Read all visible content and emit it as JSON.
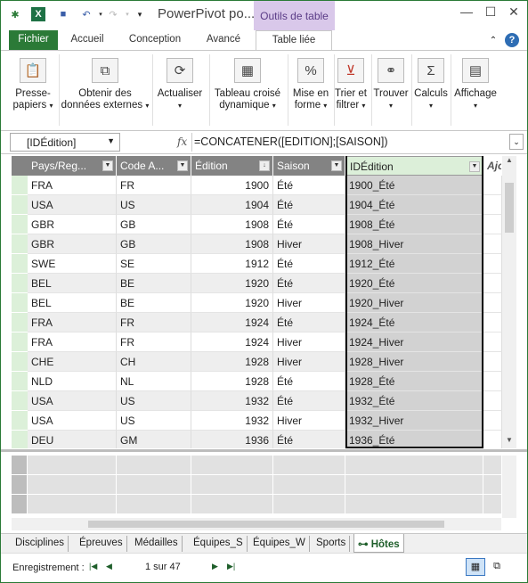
{
  "title_bar": {
    "app_title": "PowerPivot po...",
    "contextual_tab": "Outils de table",
    "minimize": "—",
    "maximize": "☐",
    "close": "✕"
  },
  "ribbon_tabs": [
    "Fichier",
    "Accueil",
    "Conception",
    "Avancé",
    "Table liée"
  ],
  "ribbon_groups": [
    {
      "line1": "Presse-",
      "line2": "papiers",
      "icon": "clipboard-icon"
    },
    {
      "line1": "Obtenir des",
      "line2": "données externes",
      "icon": "external-data-icon"
    },
    {
      "line1": "Actualiser",
      "line2": "",
      "icon": "refresh-icon"
    },
    {
      "line1": "Tableau croisé",
      "line2": "dynamique",
      "icon": "pivot-table-icon"
    },
    {
      "line1": "Mise en",
      "line2": "forme",
      "icon": "percent-format-icon"
    },
    {
      "line1": "Trier et",
      "line2": "filtrer",
      "icon": "sort-filter-icon"
    },
    {
      "line1": "Trouver",
      "line2": "",
      "icon": "binoculars-icon"
    },
    {
      "line1": "Calculs",
      "line2": "",
      "icon": "sigma-icon"
    },
    {
      "line1": "Affichage",
      "line2": "",
      "icon": "view-icon"
    }
  ],
  "formula_bar": {
    "name_box": "[IDÉdition]",
    "fx": "fx",
    "formula": "=CONCATENER([EDITION];[SAISON])"
  },
  "table": {
    "columns": [
      "Pays/Reg...",
      "Code A...",
      "Édition",
      "Saison",
      "IDÉdition",
      "Ajo"
    ],
    "rows": [
      [
        "FRA",
        "FR",
        "1900",
        "Été",
        "1900_Été"
      ],
      [
        "USA",
        "US",
        "1904",
        "Été",
        "1904_Été"
      ],
      [
        "GBR",
        "GB",
        "1908",
        "Été",
        "1908_Été"
      ],
      [
        "GBR",
        "GB",
        "1908",
        "Hiver",
        "1908_Hiver"
      ],
      [
        "SWE",
        "SE",
        "1912",
        "Été",
        "1912_Été"
      ],
      [
        "BEL",
        "BE",
        "1920",
        "Été",
        "1920_Été"
      ],
      [
        "BEL",
        "BE",
        "1920",
        "Hiver",
        "1920_Hiver"
      ],
      [
        "FRA",
        "FR",
        "1924",
        "Été",
        "1924_Été"
      ],
      [
        "FRA",
        "FR",
        "1924",
        "Hiver",
        "1924_Hiver"
      ],
      [
        "CHE",
        "CH",
        "1928",
        "Hiver",
        "1928_Hiver"
      ],
      [
        "NLD",
        "NL",
        "1928",
        "Été",
        "1928_Été"
      ],
      [
        "USA",
        "US",
        "1932",
        "Été",
        "1932_Été"
      ],
      [
        "USA",
        "US",
        "1932",
        "Hiver",
        "1932_Hiver"
      ],
      [
        "DEU",
        "GM",
        "1936",
        "Été",
        "1936_Été"
      ]
    ]
  },
  "sheet_tabs": [
    "Disciplines",
    "Épreuves",
    "Médailles",
    "Équipes_S",
    "Équipes_W",
    "Sports",
    "Hôtes"
  ],
  "active_sheet": "Hôtes",
  "status": {
    "label": "Enregistrement :",
    "record": "1 sur 47"
  }
}
